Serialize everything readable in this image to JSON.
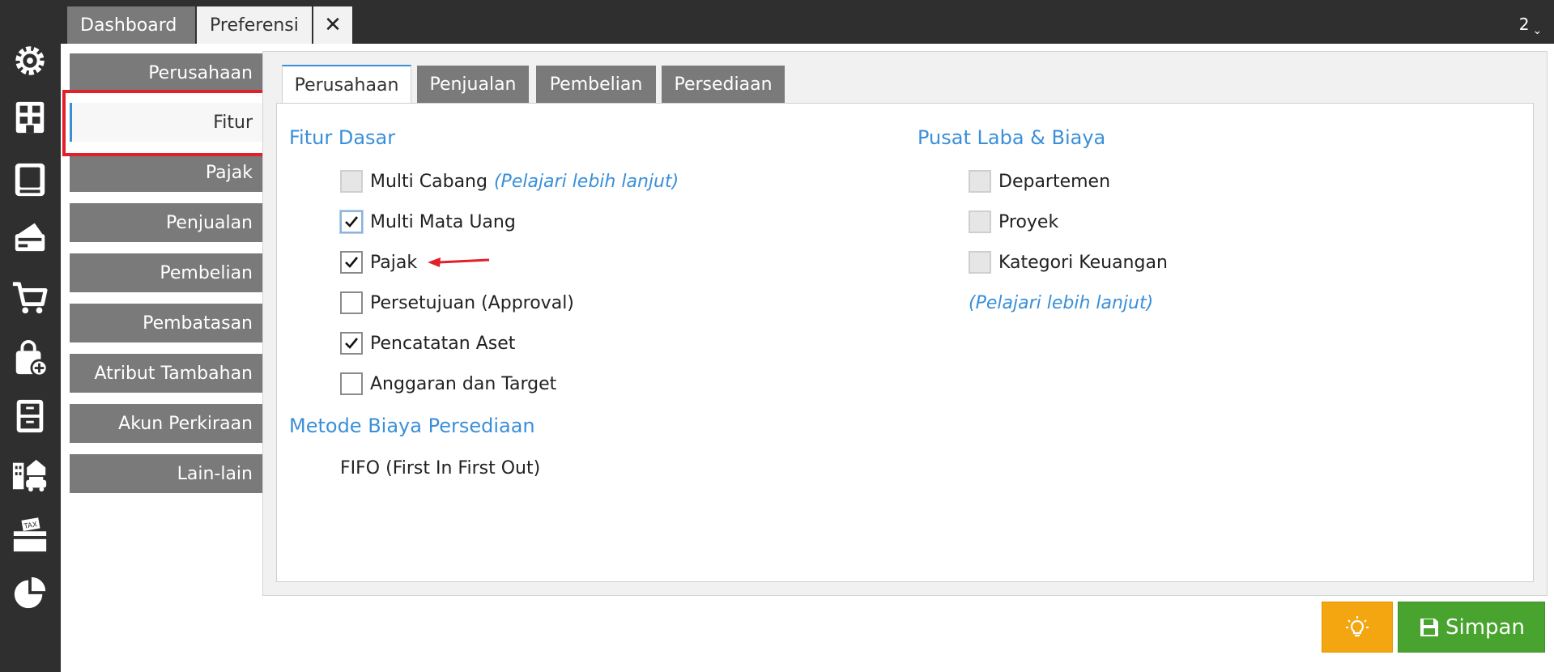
{
  "window_tabs": {
    "dashboard": "Dashboard",
    "preferensi": "Preferensi",
    "close_glyph": "✕",
    "counter": "2",
    "counter_chevron": "⌄"
  },
  "rail_icons": [
    "gear-icon",
    "building-icon",
    "book-icon",
    "payment-icon",
    "cart-icon",
    "bag-add-icon",
    "cabinet-icon",
    "assets-icon",
    "tax-icon",
    "pie-chart-icon"
  ],
  "side_nav": {
    "items": [
      "Perusahaan",
      "Fitur",
      "Pajak",
      "Penjualan",
      "Pembelian",
      "Pembatasan",
      "Atribut Tambahan",
      "Akun Perkiraan",
      "Lain-lain"
    ],
    "active": "Fitur"
  },
  "inner_tabs": [
    "Perusahaan",
    "Penjualan",
    "Pembelian",
    "Persediaan"
  ],
  "fitur_dasar": {
    "title": "Fitur Dasar",
    "multi_cabang": "Multi Cabang",
    "multi_cabang_link": "(Pelajari lebih lanjut)",
    "multi_mata_uang": "Multi Mata Uang",
    "pajak": "Pajak",
    "persetujuan": "Persetujuan (Approval)",
    "pencatatan_aset": "Pencatatan Aset",
    "anggaran": "Anggaran dan Target"
  },
  "metode_biaya": {
    "title": "Metode Biaya Persediaan",
    "value": "FIFO (First In First Out)"
  },
  "pusat_laba": {
    "title": "Pusat Laba & Biaya",
    "departemen": "Departemen",
    "proyek": "Proyek",
    "kategori": "Kategori Keuangan",
    "link": "(Pelajari lebih lanjut)"
  },
  "buttons": {
    "save": "Simpan"
  },
  "colors": {
    "accent": "#3a8fd9",
    "brand_line": "#a3122a",
    "highlight": "#e2202a",
    "save": "#49a42f",
    "tip": "#f3a60f"
  }
}
